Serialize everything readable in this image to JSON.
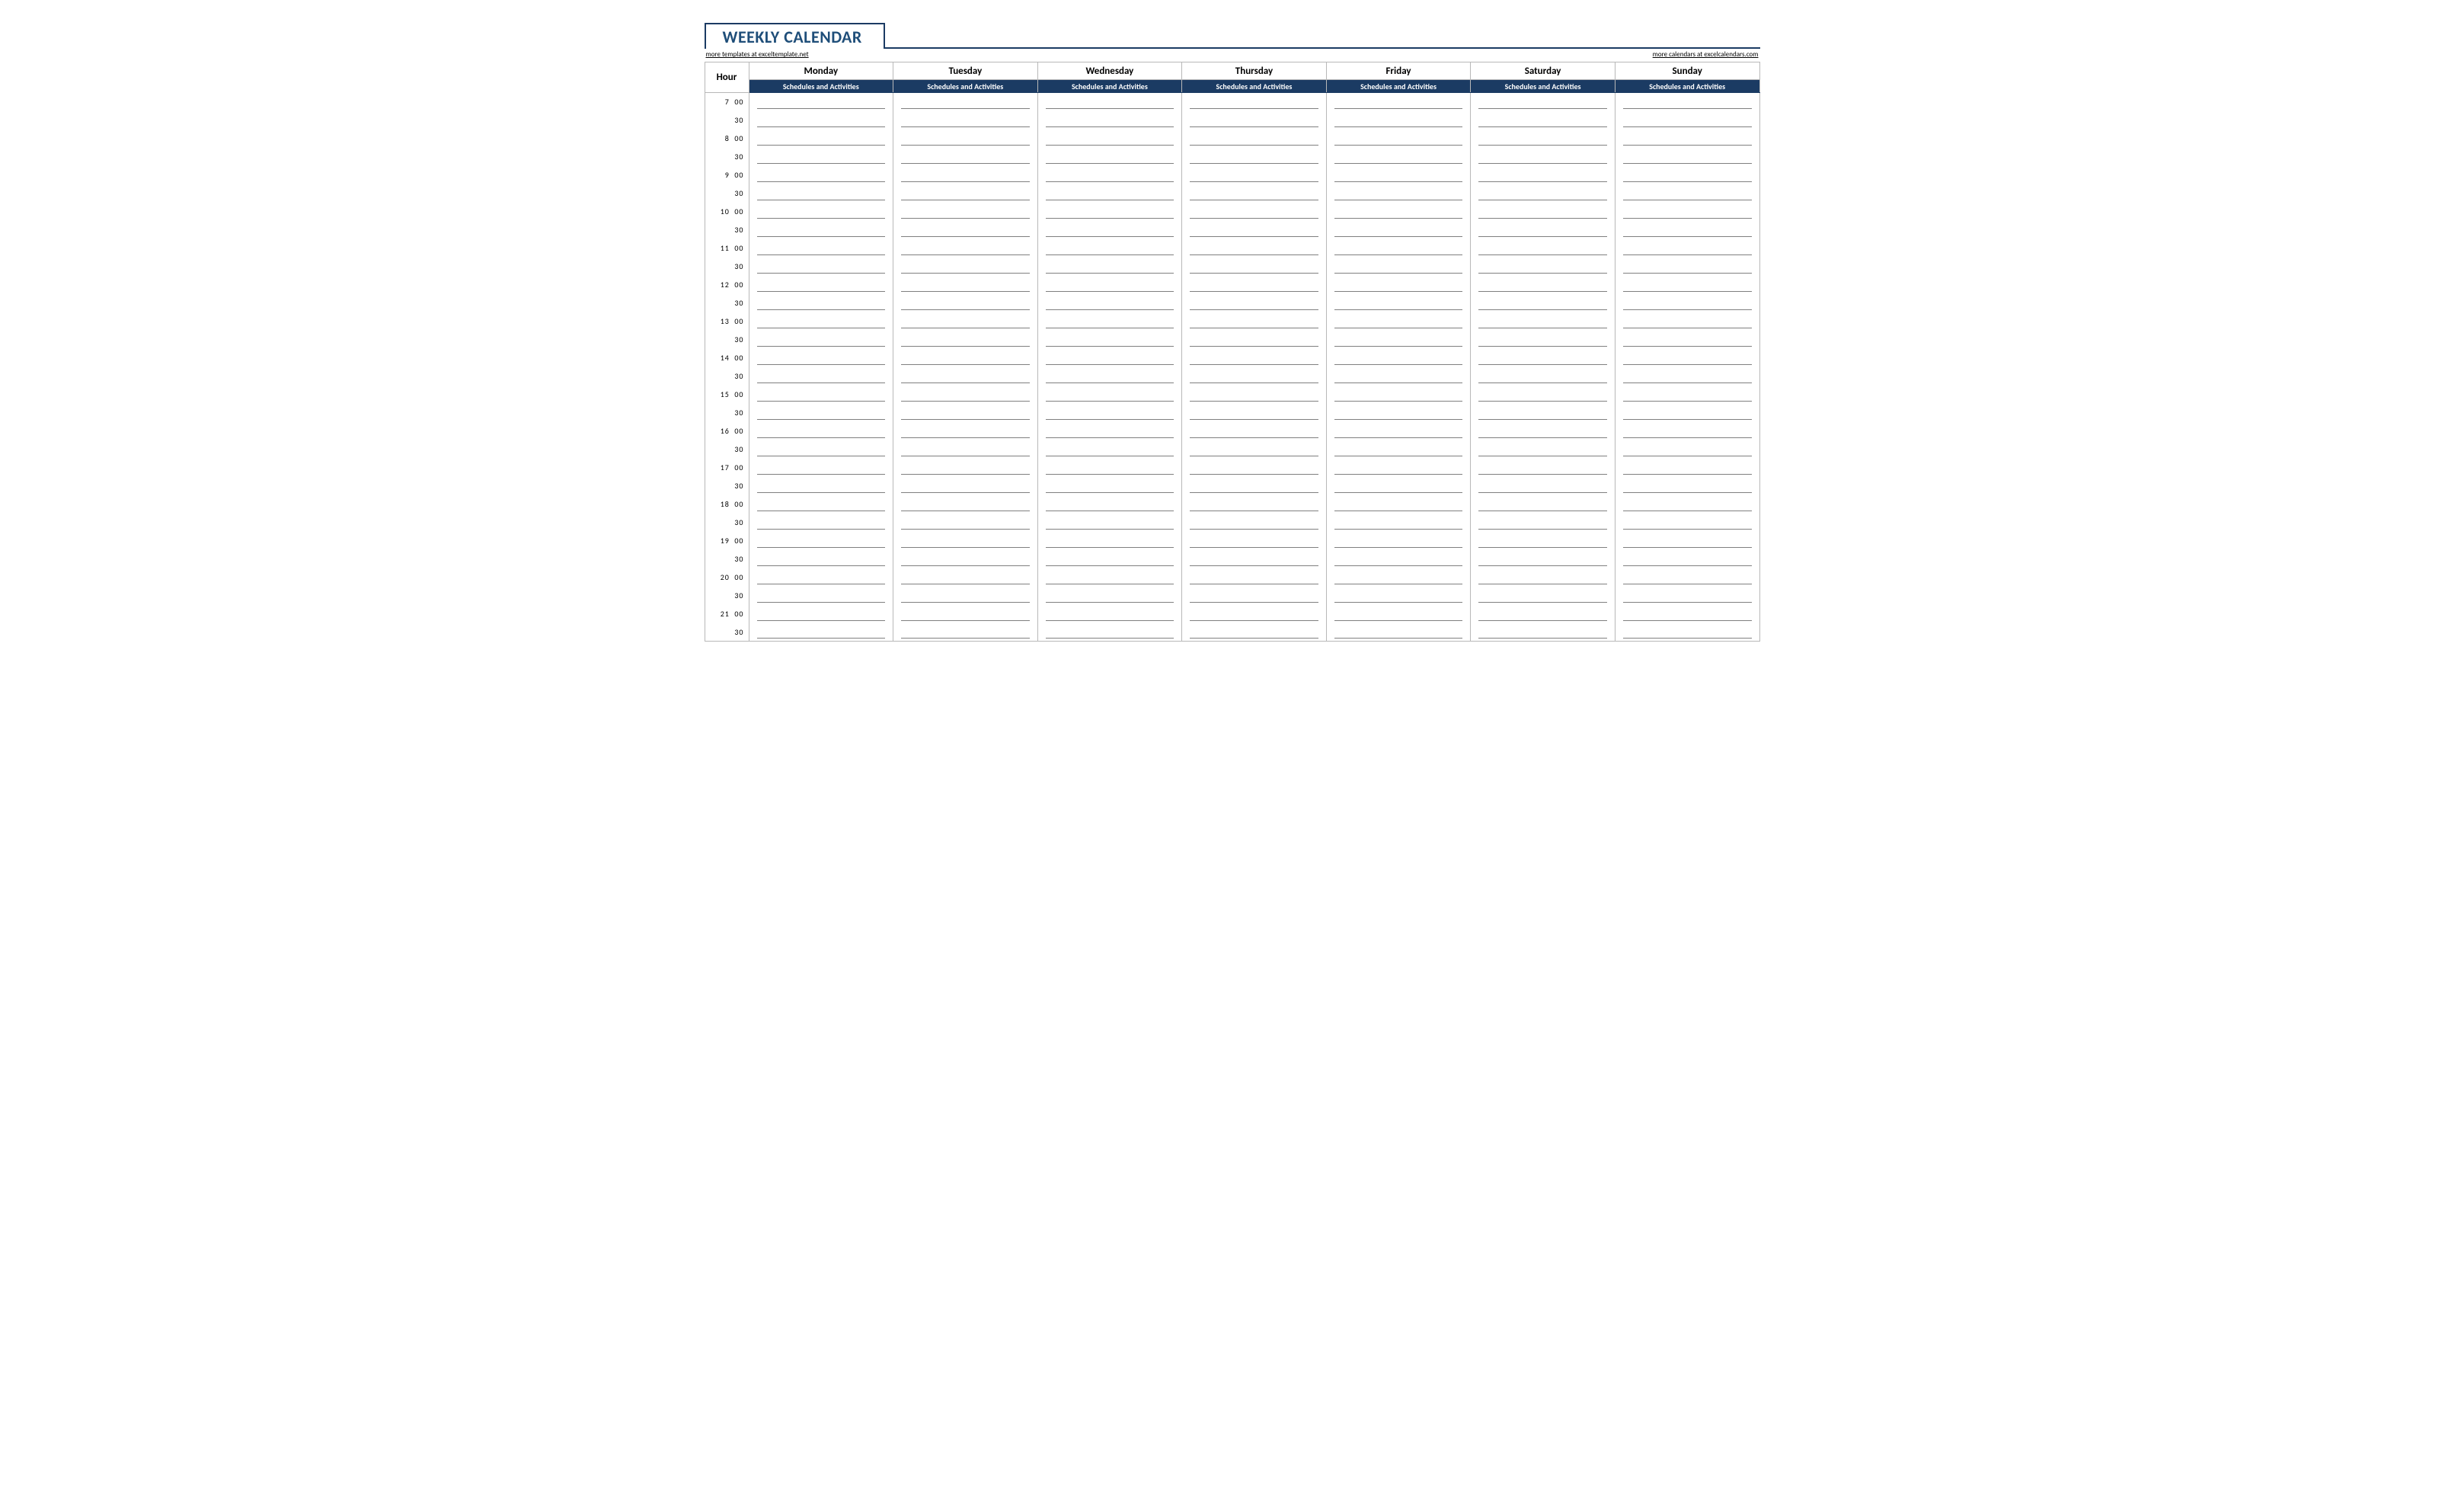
{
  "title": "WEEKLY CALENDAR",
  "link_left": "more templates at exceltemplate.net",
  "link_right": "more calendars at excelcalendars.com",
  "hour_header": "Hour",
  "days": [
    "Monday",
    "Tuesday",
    "Wednesday",
    "Thursday",
    "Friday",
    "Saturday",
    "Sunday"
  ],
  "subheader": "Schedules and Activities",
  "hours_start": 7,
  "hours_end": 21,
  "minute_labels": [
    "00",
    "30"
  ]
}
